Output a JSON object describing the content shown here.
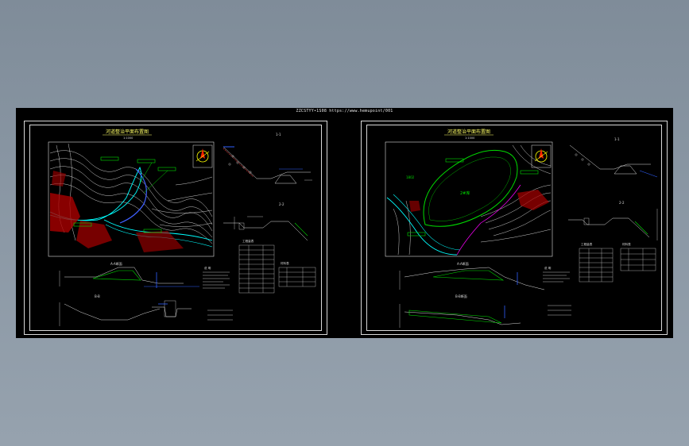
{
  "viewer": {
    "drawing_title": "ZZCSTYY•1S08 https://www.hemupoint/001"
  },
  "sheet_left": {
    "plan_title": "河道整治平面布置图",
    "plan_scale": "1:1000",
    "section_1_title": "1-1",
    "section_2_title": "2-2",
    "section_a_title": "A-A断面",
    "section_b_title": "B-B",
    "table_title": "工程量表",
    "table2_title": "材料表",
    "notes_title": "说 明",
    "label_a": "A",
    "label_b": "B"
  },
  "sheet_right": {
    "plan_title": "河道整治平面布置图",
    "plan_scale": "1:1000",
    "section_1_title": "1-1",
    "section_2_title": "2-2",
    "section_a_title": "A-A断面",
    "section_b_title": "B-B断面",
    "table_title": "工程量表",
    "table2_title": "材料表",
    "notes_title": "说 明",
    "label_a": "1802",
    "label_b": "2#库"
  },
  "colors": {
    "background": "#000000",
    "frame": "#d8d8d8",
    "contour": "#ffffff",
    "river": "#00ffff",
    "boundary": "#ff0000",
    "fill_green": "#00cc00",
    "dimension_blue": "#3060ff",
    "highlight_magenta": "#ff00ff",
    "compass_yellow": "#ffff00"
  }
}
